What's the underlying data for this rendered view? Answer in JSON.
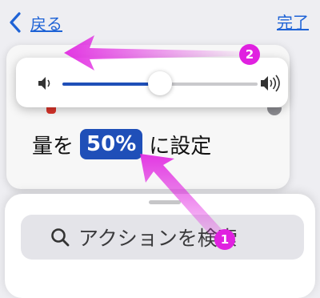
{
  "nav": {
    "back_label": "戻る",
    "done_label": "完了"
  },
  "volume": {
    "level": 0.5
  },
  "action": {
    "prefix": "量を",
    "percent": "50%",
    "suffix": "に設定"
  },
  "search": {
    "placeholder": "アクションを検索"
  },
  "annotations": {
    "marker_1": "1",
    "marker_2": "2",
    "color": "#e021e0"
  },
  "colors": {
    "accent": "#1f63d6",
    "chip": "#1f4fb8"
  },
  "icons": [
    "chevron-left-icon",
    "speaker-low-icon",
    "speaker-high-icon",
    "search-icon"
  ]
}
